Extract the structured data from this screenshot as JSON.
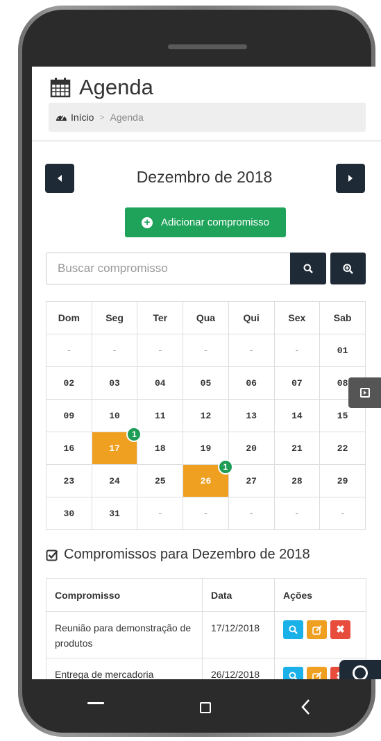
{
  "header": {
    "title": "Agenda",
    "icon": "calendar-icon",
    "breadcrumb": {
      "home": "Início",
      "separator": ">",
      "current": "Agenda"
    }
  },
  "month_nav": {
    "label": "Dezembro de 2018",
    "prev_icon": "triangle-left-icon",
    "next_icon": "triangle-right-icon"
  },
  "add_button": {
    "label": "Adicionar compromisso",
    "icon": "plus-circle-icon"
  },
  "search": {
    "placeholder": "Buscar compromisso",
    "value": ""
  },
  "calendar": {
    "weekdays": [
      "Dom",
      "Seg",
      "Ter",
      "Qua",
      "Qui",
      "Sex",
      "Sab"
    ],
    "weeks": [
      [
        "-",
        "-",
        "-",
        "-",
        "-",
        "-",
        "01"
      ],
      [
        "02",
        "03",
        "04",
        "05",
        "06",
        "07",
        "08"
      ],
      [
        "09",
        "10",
        "11",
        "12",
        "13",
        "14",
        "15"
      ],
      [
        "16",
        "17",
        "18",
        "19",
        "20",
        "21",
        "22"
      ],
      [
        "23",
        "24",
        "25",
        "26",
        "27",
        "28",
        "29"
      ],
      [
        "30",
        "31",
        "-",
        "-",
        "-",
        "-",
        "-"
      ]
    ],
    "events": {
      "17": "1",
      "26": "1"
    },
    "event_color": "#f0a020",
    "badge_color": "#1f9c55"
  },
  "appointments": {
    "title": "Compromissos para Dezembro de 2018",
    "columns": [
      "Compromisso",
      "Data",
      "Ações"
    ],
    "rows": [
      {
        "name": "Reunião para demonstração de produtos",
        "date": "17/12/2018"
      },
      {
        "name": "Entrega de mercadoria",
        "date": "26/12/2018"
      }
    ]
  },
  "colors": {
    "dark": "#1f2a37",
    "green": "#1fa35a",
    "info": "#1ab0e8",
    "warning": "#f0a020",
    "danger": "#e74c3c"
  }
}
